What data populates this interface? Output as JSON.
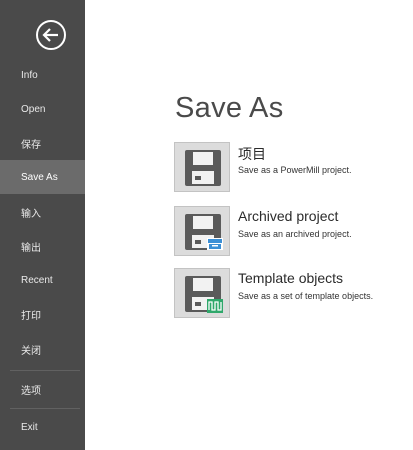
{
  "sidebar": {
    "back_icon": "back-arrow-icon",
    "items": [
      {
        "label": "Info"
      },
      {
        "label": "Open"
      },
      {
        "label": "保存"
      },
      {
        "label": "Save As",
        "active": true
      },
      {
        "label": "输入"
      },
      {
        "label": "输出"
      },
      {
        "label": "Recent"
      },
      {
        "label": "打印"
      },
      {
        "label": "关闭"
      },
      {
        "label": "选项"
      },
      {
        "label": "Exit"
      }
    ]
  },
  "main": {
    "title": "Save As",
    "options": [
      {
        "title": "项目",
        "description": "Save as a PowerMill project.",
        "icon": "floppy-disk-icon"
      },
      {
        "title": "Archived project",
        "description": "Save as an archived project.",
        "icon": "floppy-disk-archive-icon"
      },
      {
        "title": "Template objects",
        "description": "Save as a set of template objects.",
        "icon": "floppy-disk-template-icon"
      }
    ]
  },
  "colors": {
    "sidebar_bg": "#4a4a4a",
    "sidebar_active": "#6b6b6b",
    "archive_accent": "#3a8fd6",
    "template_accent": "#2fa86b"
  }
}
